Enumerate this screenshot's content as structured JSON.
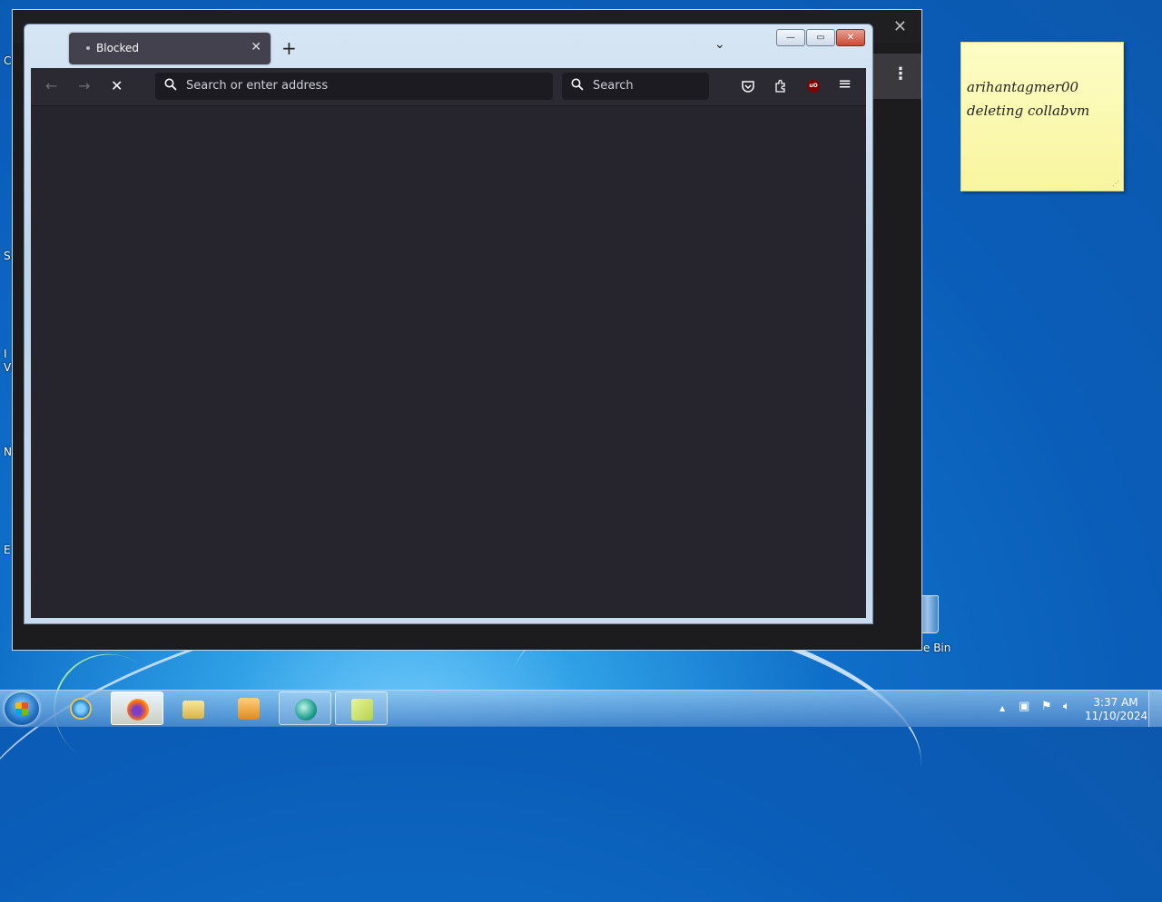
{
  "desktop": {
    "edge_labels": [
      "C",
      "S",
      "I",
      "Vi",
      "N",
      "E"
    ],
    "recycle_bin_label": "e Bin"
  },
  "browser": {
    "tab": {
      "label": "Blocked",
      "close": "✕"
    },
    "new_tab": "+",
    "tab_list": "⌄",
    "nav": {
      "back": "←",
      "forward": "→",
      "stop": "✕"
    },
    "urlbar": {
      "placeholder": "Search or enter address"
    },
    "searchbar": {
      "placeholder": "Search"
    },
    "window_controls": {
      "minimize": "—",
      "maximize": "▭",
      "close": "✕"
    },
    "menu_icon": "≡",
    "ublock_label": "uO"
  },
  "background_window": {
    "close": "✕",
    "menu": "⋮"
  },
  "sticky_note": {
    "lines": [
      "arihantagmer00",
      "deleting collabvm"
    ]
  },
  "taskbar": {
    "clock_time": "3:37 AM",
    "clock_date": "11/10/2024",
    "tray_arrow": "▲"
  }
}
